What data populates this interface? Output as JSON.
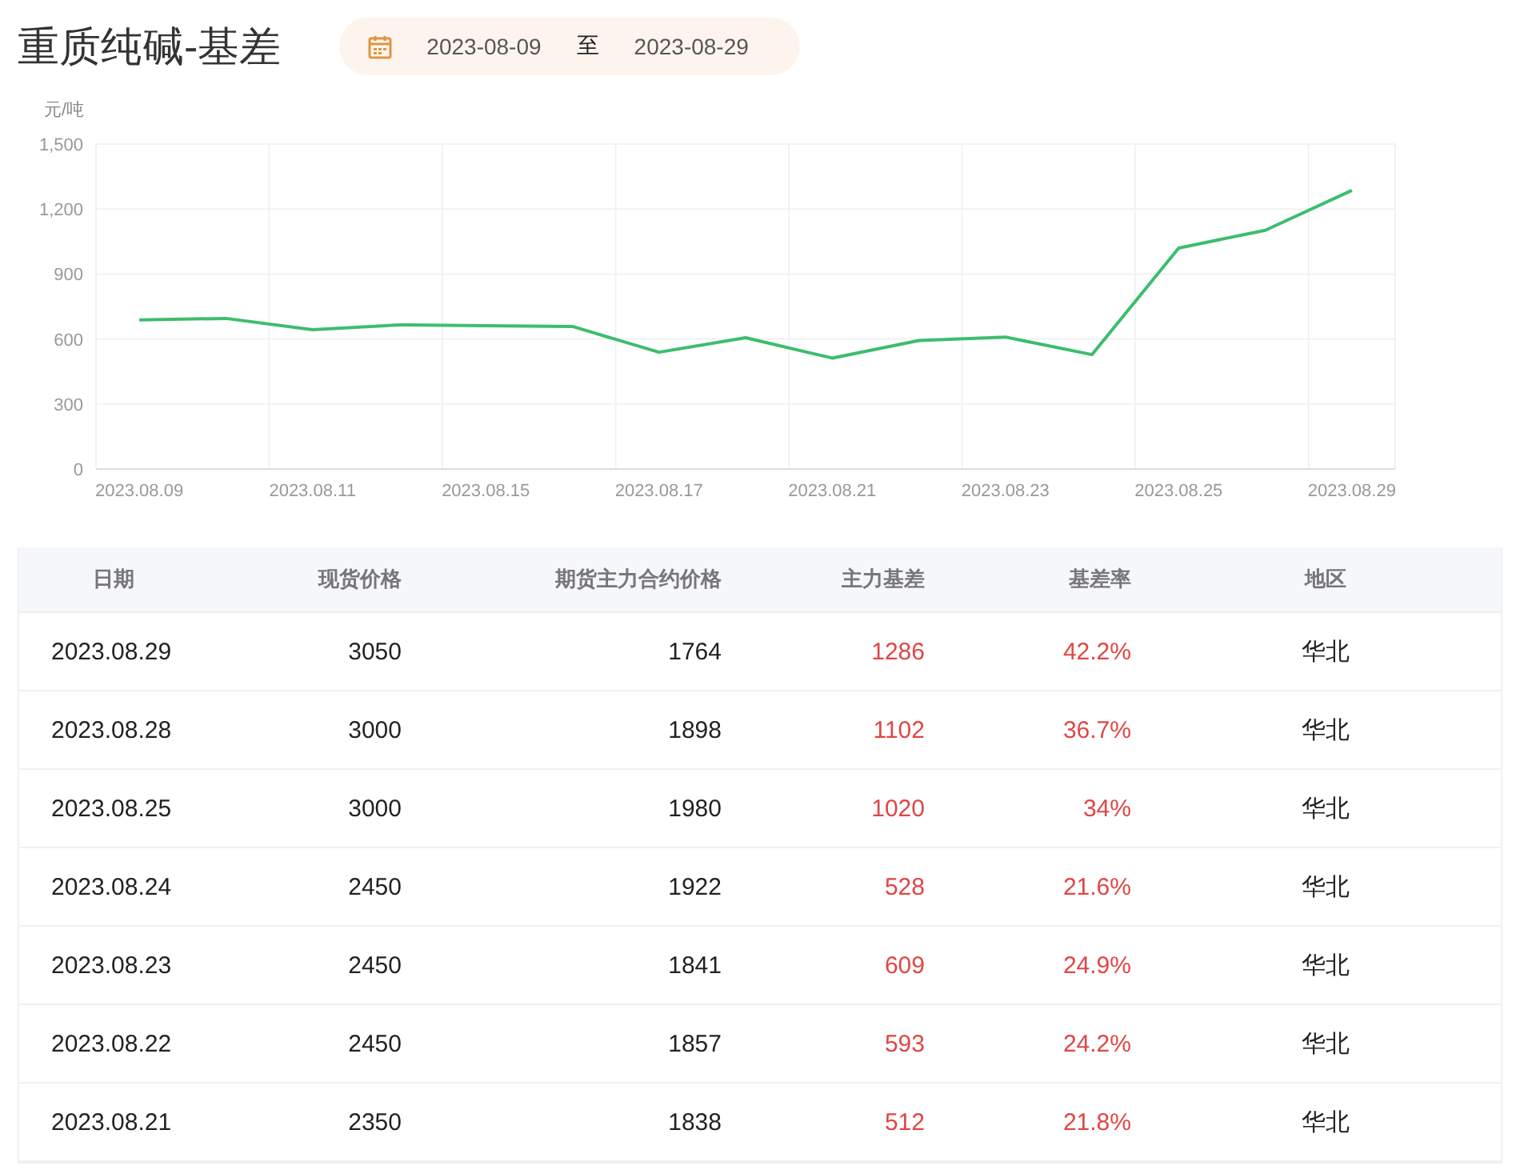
{
  "title": "重质纯碱-基差",
  "date_range": {
    "start": "2023-08-09",
    "separator": "至",
    "end": "2023-08-29"
  },
  "chart_data": {
    "type": "line",
    "ylabel": "元/吨",
    "categories": [
      "2023.08.09",
      null,
      "2023.08.11",
      null,
      "2023.08.15",
      null,
      "2023.08.17",
      null,
      "2023.08.21",
      null,
      "2023.08.23",
      null,
      "2023.08.25",
      null,
      "2023.08.29"
    ],
    "series": [
      {
        "color": "#3dbd6e",
        "values": [
          688,
          695,
          643,
          665,
          661,
          658,
          539,
          606,
          512,
          593,
          609,
          528,
          1020,
          1102,
          1286
        ]
      }
    ],
    "grid": true,
    "ylim": [
      0,
      1500
    ],
    "yticks": [
      {
        "value": 0,
        "label": "0"
      },
      {
        "value": 300,
        "label": "300"
      },
      {
        "value": 600,
        "label": "600"
      },
      {
        "value": 900,
        "label": "900"
      },
      {
        "value": 1200,
        "label": "1,200"
      },
      {
        "value": 1500,
        "label": "1,500"
      }
    ]
  },
  "table": {
    "columns": [
      "日期",
      "现货价格",
      "期货主力合约价格",
      "主力基差",
      "基差率",
      "地区"
    ],
    "rows": [
      [
        "2023.08.29",
        "3050",
        "1764",
        "1286",
        "42.2%",
        "华北"
      ],
      [
        "2023.08.28",
        "3000",
        "1898",
        "1102",
        "36.7%",
        "华北"
      ],
      [
        "2023.08.25",
        "3000",
        "1980",
        "1020",
        "34%",
        "华北"
      ],
      [
        "2023.08.24",
        "2450",
        "1922",
        "528",
        "21.6%",
        "华北"
      ],
      [
        "2023.08.23",
        "2450",
        "1841",
        "609",
        "24.9%",
        "华北"
      ],
      [
        "2023.08.22",
        "2450",
        "1857",
        "593",
        "24.2%",
        "华北"
      ],
      [
        "2023.08.21",
        "2350",
        "1838",
        "512",
        "21.8%",
        "华北"
      ]
    ]
  }
}
